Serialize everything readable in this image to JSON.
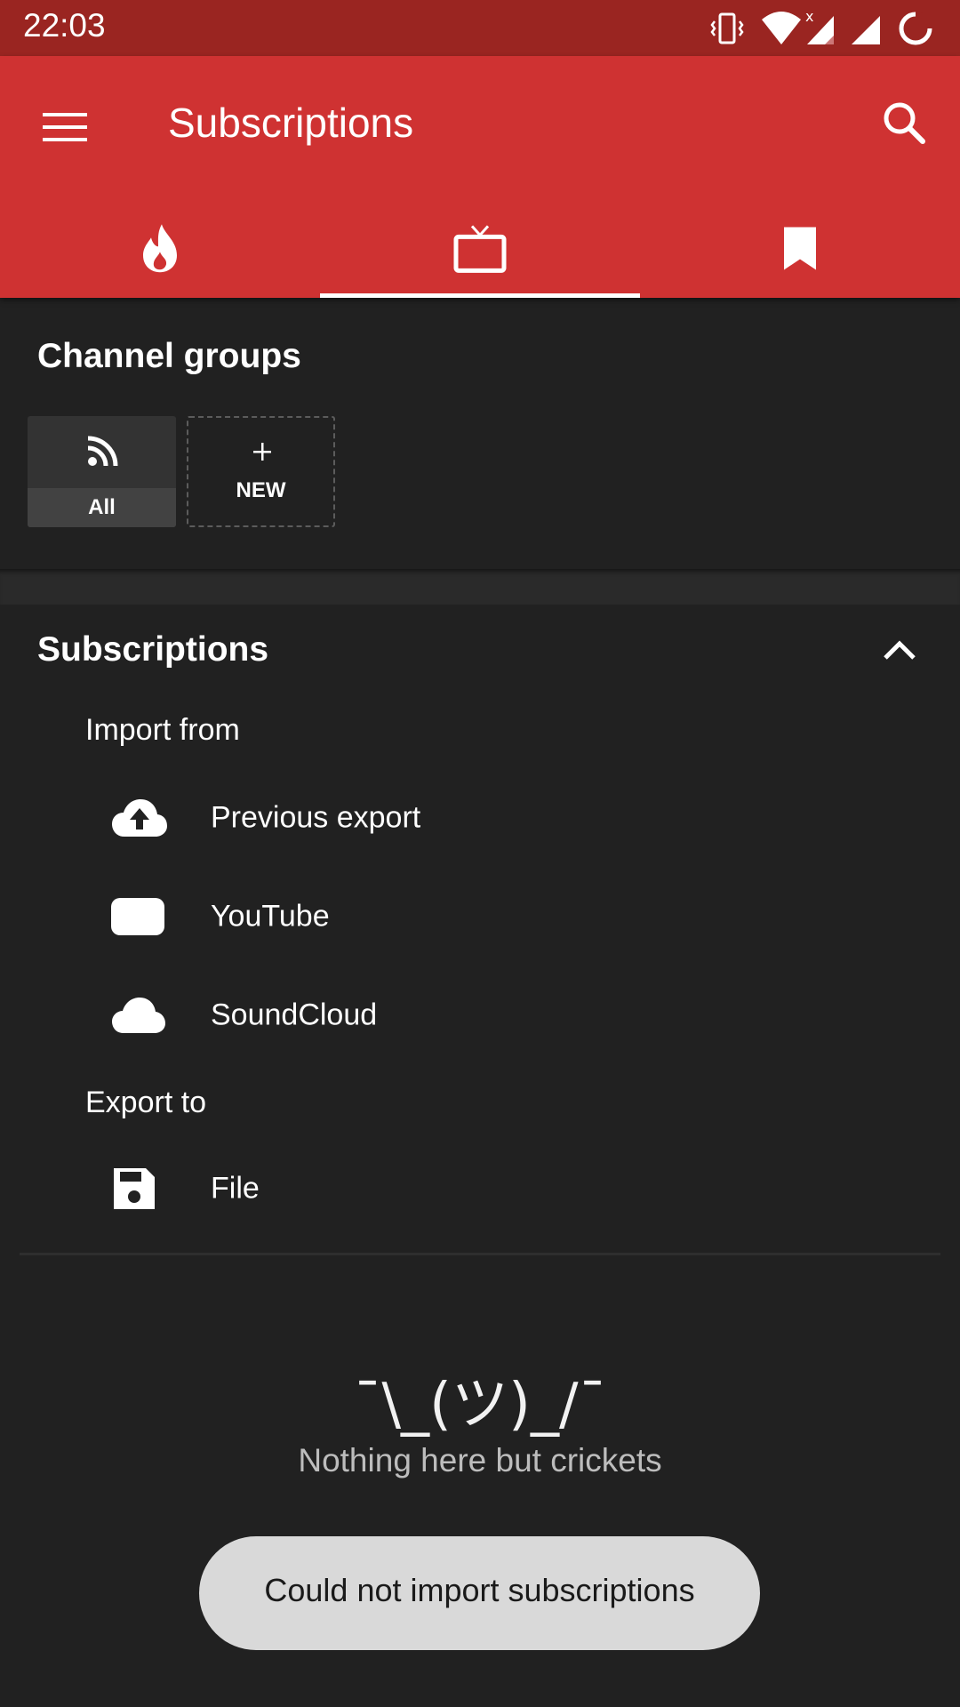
{
  "status_bar": {
    "time": "22:03",
    "icons": [
      "vibrate-icon",
      "wifi-icon",
      "signal-icon",
      "signal-icon",
      "sync-icon"
    ]
  },
  "app_bar": {
    "title": "Subscriptions",
    "menu_icon": "hamburger-menu-icon",
    "search_icon": "search-icon",
    "tabs": [
      {
        "icon": "fire-trending-icon",
        "selected": false
      },
      {
        "icon": "tv-subscriptions-icon",
        "selected": true
      },
      {
        "icon": "bookmark-icon",
        "selected": false
      }
    ]
  },
  "channel_groups": {
    "title": "Channel groups",
    "groups": [
      {
        "label": "All",
        "icon": "rss-feed-icon"
      },
      {
        "label": "NEW",
        "icon": "plus-icon"
      }
    ]
  },
  "subscriptions": {
    "title": "Subscriptions",
    "collapse_icon": "chevron-up-icon",
    "import_label": "Import from",
    "import_items": [
      {
        "label": "Previous export",
        "icon": "cloud-upload-icon"
      },
      {
        "label": "YouTube",
        "icon": "youtube-icon"
      },
      {
        "label": "SoundCloud",
        "icon": "cloud-icon"
      }
    ],
    "export_label": "Export to",
    "export_items": [
      {
        "label": "File",
        "icon": "floppy-save-icon"
      }
    ]
  },
  "empty_state": {
    "emoticon": "¯\\_(ツ)_/¯",
    "message": "Nothing here but crickets"
  },
  "toast": {
    "message": "Could not import subscriptions"
  },
  "colors": {
    "status_bar": "#9a2521",
    "app_bar": "#cf3232",
    "background": "#212121",
    "toast": "#d9d9d9"
  }
}
